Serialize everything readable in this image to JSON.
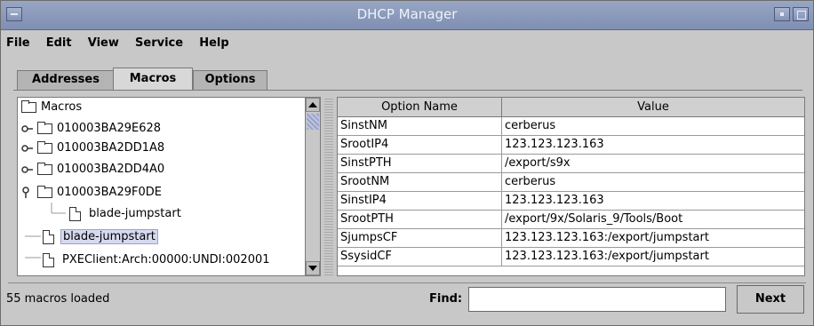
{
  "window": {
    "title": "DHCP Manager"
  },
  "menu": [
    {
      "label": "File"
    },
    {
      "label": "Edit"
    },
    {
      "label": "View"
    },
    {
      "label": "Service"
    },
    {
      "label": "Help"
    }
  ],
  "tabs": [
    {
      "label": "Addresses",
      "active": false
    },
    {
      "label": "Macros",
      "active": true
    },
    {
      "label": "Options",
      "active": false
    }
  ],
  "tree": {
    "root": "Macros",
    "nodes": [
      {
        "label": "010003BA29E628",
        "kind": "folder",
        "expanded": false
      },
      {
        "label": "010003BA2DD1A8",
        "kind": "folder",
        "expanded": false
      },
      {
        "label": "010003BA2DD4A0",
        "kind": "folder",
        "expanded": false
      },
      {
        "label": "010003BA29F0DE",
        "kind": "folder",
        "expanded": true
      },
      {
        "label": "blade-jumpstart",
        "kind": "doc",
        "child": true
      },
      {
        "label": "blade-jumpstart",
        "kind": "doc",
        "selected": true
      },
      {
        "label": "PXEClient:Arch:00000:UNDI:002001",
        "kind": "doc"
      }
    ]
  },
  "table": {
    "headers": [
      "Option Name",
      "Value"
    ],
    "rows": [
      [
        "SinstNM",
        "cerberus"
      ],
      [
        "SrootIP4",
        "123.123.123.163"
      ],
      [
        "SinstPTH",
        "/export/s9x"
      ],
      [
        "SrootNM",
        "cerberus"
      ],
      [
        "SinstIP4",
        "123.123.123.163"
      ],
      [
        "SrootPTH",
        "/export/9x/Solaris_9/Tools/Boot"
      ],
      [
        "SjumpsCF",
        "123.123.123.163:/export/jumpstart"
      ],
      [
        "SsysidCF",
        "123.123.123.163:/export/jumpstart"
      ]
    ]
  },
  "status": {
    "text": "55 macros loaded",
    "find_label": "Find:",
    "find_value": "",
    "next_label": "Next"
  }
}
